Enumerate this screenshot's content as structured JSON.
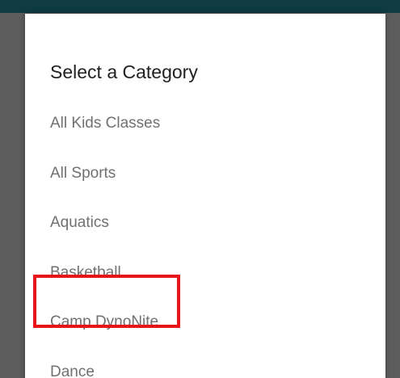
{
  "dialog": {
    "title": "Select a Category",
    "categories": [
      {
        "label": "All Kids Classes"
      },
      {
        "label": "All Sports"
      },
      {
        "label": "Aquatics"
      },
      {
        "label": "Basketball"
      },
      {
        "label": "Camp DynoNite",
        "highlighted": true
      },
      {
        "label": "Dance"
      }
    ]
  },
  "colors": {
    "app_bar": "#0f3b45",
    "scrim": "#5d5d5d",
    "dialog_background": "#ffffff",
    "title_text": "#212121",
    "item_text": "#707070",
    "highlight_border": "#e8141b"
  }
}
